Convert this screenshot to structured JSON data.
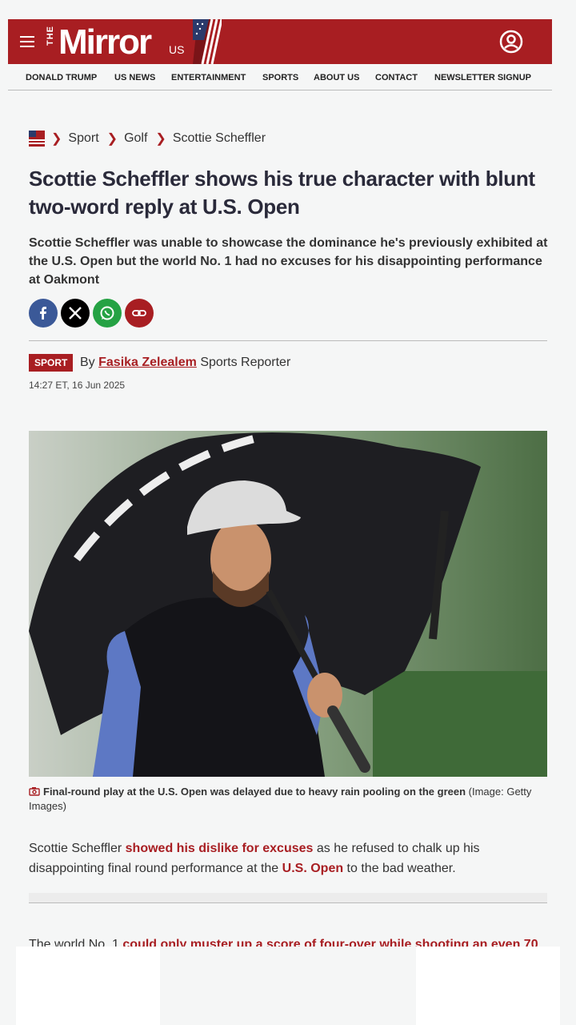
{
  "header": {
    "logo_the": "THE",
    "logo_name": "Mirror",
    "logo_region": "US",
    "menu_icon": "hamburger-icon",
    "account_icon": "user-account-icon",
    "brand_color": "#a81e22"
  },
  "nav": {
    "items": [
      "DONALD TRUMP",
      "US NEWS",
      "ENTERTAINMENT",
      "SPORTS",
      "ABOUT US",
      "CONTACT",
      "NEWSLETTER SIGNUP"
    ]
  },
  "breadcrumb": {
    "items": [
      "Sport",
      "Golf",
      "Scottie Scheffler"
    ]
  },
  "article": {
    "title": "Scottie Scheffler shows his true character with blunt two-word reply at U.S. Open",
    "subtitle": "Scottie Scheffler was unable to showcase the dominance he's previously exhibited at the U.S. Open but the world No. 1 had no excuses for his disappointing performance at Oakmont",
    "share_icons": [
      "facebook-icon",
      "x-icon",
      "whatsapp-icon",
      "link-icon"
    ],
    "tag": "SPORT",
    "by": "By",
    "author": "Fasika Zelealem",
    "role": "Sports Reporter",
    "date": "14:27 ET, 16 Jun 2025",
    "image_caption": "Final-round play at the U.S. Open was delayed due to heavy rain pooling on the green",
    "image_credit": "(Image: Getty Images)",
    "para1": {
      "t1": "Scottie Scheffler ",
      "link1": "showed his dislike for excuses",
      "t2": " as he refused to chalk up his disappointing final round performance at the ",
      "link2": "U.S. Open",
      "t3": " to the bad weather."
    },
    "para2": {
      "t1": "The world No. 1 ",
      "link1": "could only muster up a score of four-over while shooting an even 70"
    }
  }
}
